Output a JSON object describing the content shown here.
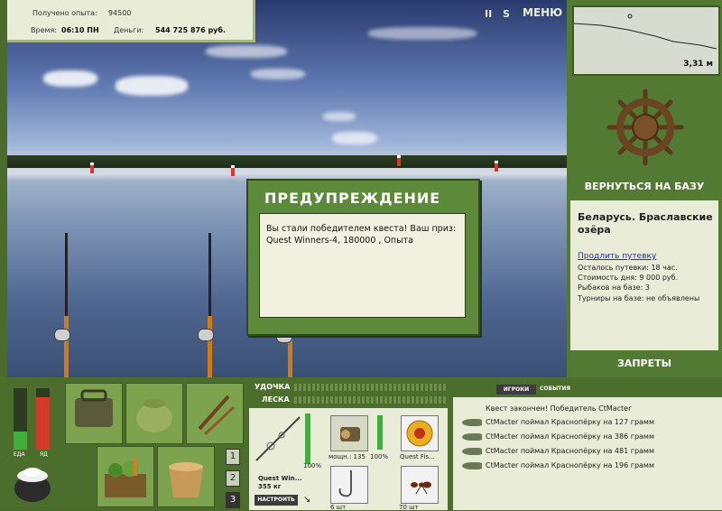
{
  "top_info": {
    "experience_label": "Получено опыта:",
    "experience_value": "94500",
    "time_label": "Время:",
    "time_value": "06:10 ПН",
    "money_label": "Деньги:",
    "money_value": "544 725 876 руб."
  },
  "top_buttons": {
    "pause": "II",
    "sound": "S",
    "menu": "МЕНЮ"
  },
  "depth": {
    "value": "3,31 м"
  },
  "right_panel": {
    "back_to_base": "ВЕРНУТЬСЯ НА БАЗУ",
    "location": "Беларусь. Браславские озёра",
    "extend_link": "Продлить путевку",
    "remaining": "Осталось путевки: 18 час.",
    "day_cost": "Стоимость дня: 9 000 руб.",
    "fishers": "Рыбаков на базе: 3",
    "tournaments": "Турниры на базе: не объявлены",
    "bans": "ЗАПРЕТЫ"
  },
  "dialog": {
    "title": "ПРЕДУПРЕЖДЕНИЕ",
    "message": "Вы стали победителем квеста! Ваш приз: Quest Winners-4, 180000 , Опыта"
  },
  "status": {
    "food_label": "ЕДА",
    "poison_label": "ЯД",
    "food_level": 0.3,
    "poison_level": 0.85
  },
  "inventory": {
    "pages": [
      "1",
      "2",
      "3"
    ]
  },
  "tackle": {
    "rod_label": "УДОЧКА",
    "line_label": "ЛЕСКА",
    "rod_name": "Quest Win...",
    "rod_weight": "355 кг",
    "rod_percent": "100%",
    "setup_button": "НАСТРОИТЬ",
    "reel_power": "мощн.: 135",
    "reel_percent": "100%",
    "line_name": "Quest Fis...",
    "hook_count": "6 шт",
    "bait_count": "70 шт"
  },
  "chat": {
    "tab_players": "ИГРОКИ",
    "tab_events": "СОБЫТИЯ",
    "header": "Квест закончен! Победитель CtMacter",
    "lines": [
      "CtMacter поймал Краснопёрку на 127 грамм",
      "CtMacter поймал Краснопёрку на 386 грамм",
      "CtMacter поймал Краснопёрку на 481 грамм",
      "CtMacter поймал Краснопёрку на 196 грамм"
    ]
  },
  "colors": {
    "panel_green": "#4c6e2d",
    "panel_light": "#e9ecd6",
    "dialog_green": "#5d8a3a",
    "food_bar": "#3fae3a",
    "poison_bar": "#d43a2a"
  }
}
